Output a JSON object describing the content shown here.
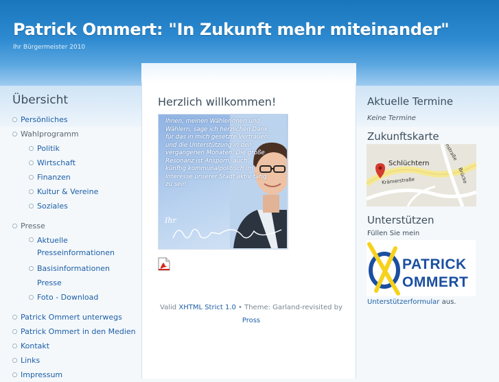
{
  "header": {
    "site_name": "Patrick Ommert: \"In Zukunft mehr miteinander\"",
    "slogan": "Ihr Bürgermeister 2010"
  },
  "sidebar_left": {
    "title": "Übersicht",
    "items": [
      {
        "label": "Persönliches"
      },
      {
        "label": "Wahlprogramm",
        "children": [
          "Politik",
          "Wirtschaft",
          "Finanzen",
          "Kultur & Vereine",
          "Soziales"
        ]
      },
      {
        "label": "Presse",
        "children": [
          "Aktuelle Presseinformationen",
          "Basisinformationen Presse",
          "Foto - Download"
        ]
      },
      {
        "label": "Patrick Ommert unterwegs"
      },
      {
        "label": "Patrick Ommert in den Medien"
      },
      {
        "label": "Kontakt"
      },
      {
        "label": "Links"
      },
      {
        "label": "Impressum"
      }
    ]
  },
  "main": {
    "title": "Herzlich willkommen!",
    "image_text": "Ihnen, meinen Wählerinnen und Wählern, sage ich herzlichen Dank für das in mich gesetzte Vertrauen und die Unterstützung in den vergangenen Monaten. Die große Resonanz ist Ansporn, auch künftig kommunalpolitisch im Interesse unserer Stadt aktiv tätig zu sein.",
    "image_sig": "Ihr",
    "pdf_icon": "pdf-icon"
  },
  "footer": {
    "valid": "Valid",
    "xhtml": "XHTML Strict 1.0",
    "theme": " • Theme: Garland-revisited by",
    "author": "Pross"
  },
  "sidebar_right": {
    "events_title": "Aktuelle Termine",
    "no_events": "Keine Termine",
    "map_title": "Zukunftskarte",
    "map_labels": {
      "city": "Schlüchtern",
      "street1": "Krämerstraße",
      "street2": "Brücke",
      "street3": "nstraße"
    },
    "support_title": "Unterstützen",
    "support_text": "Füllen Sie mein",
    "logo_name_1": "PATRICK",
    "logo_name_2": "OMMERT",
    "support_link": "Unterstützerformular",
    "support_end": " aus."
  },
  "colors": {
    "header": "#2d8ad0",
    "link": "#1d5ea6",
    "logo_blue": "#1a4fa0",
    "logo_yellow": "#f6d21c"
  }
}
